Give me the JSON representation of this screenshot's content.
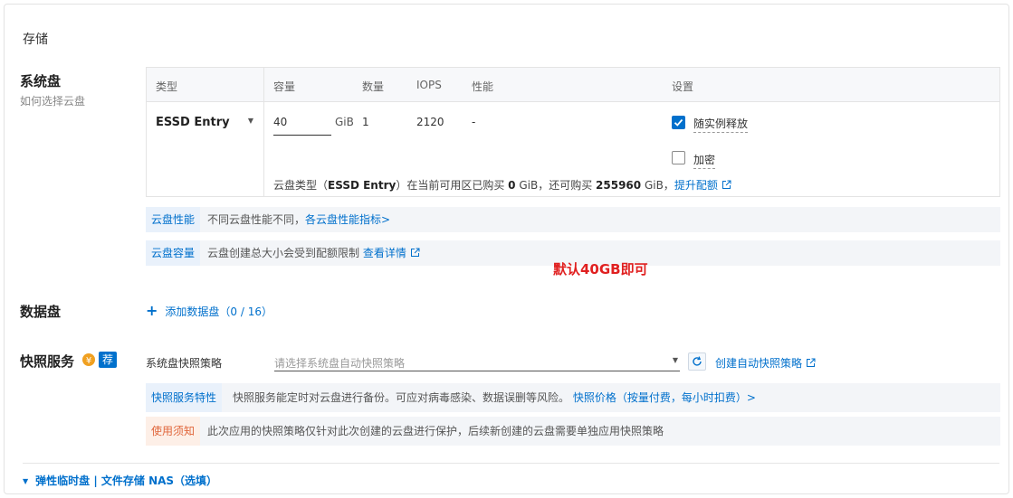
{
  "section_title": "存储",
  "system_disk": {
    "label": "系统盘",
    "help_link": "如何选择云盘",
    "table": {
      "headers": {
        "type": "类型",
        "capacity": "容量",
        "count": "数量",
        "iops": "IOPS",
        "performance": "性能",
        "settings": "设置"
      },
      "row": {
        "type": "ESSD Entry",
        "capacity": "40",
        "unit": "GiB",
        "count": "1",
        "iops": "2120",
        "performance": "-",
        "release_with_instance": "随实例释放",
        "release_checked": true,
        "encrypt": "加密",
        "encrypt_checked": false
      },
      "quota": {
        "prefix": "云盘类型（",
        "type": "ESSD Entry",
        "mid1": "）在当前可用区已购买 ",
        "bought": "0",
        "mid2": " GiB，还可购买 ",
        "remaining": "255960",
        "suffix": " GiB，",
        "link": "提升配额"
      }
    },
    "perf_bar": {
      "tag": "云盘性能",
      "text": "不同云盘性能不同，",
      "link": "各云盘性能指标>"
    },
    "capacity_bar": {
      "tag": "云盘容量",
      "text": "云盘创建总大小会受到配额限制",
      "link": "查看详情"
    },
    "annotation": "默认40GB即可"
  },
  "data_disk": {
    "label": "数据盘",
    "add_icon": "+",
    "add_text": "添加数据盘（0 / 16）"
  },
  "snapshot": {
    "label": "快照服务",
    "badge": "荐",
    "policy_label": "系统盘快照策略",
    "policy_placeholder": "请选择系统盘自动快照策略",
    "create_link": "创建自动快照策略",
    "feature_bar": {
      "tag": "快照服务特性",
      "text": "快照服务能定时对云盘进行备份。可应对病毒感染、数据误删等风险。",
      "link": "快照价格（按量付费，每小时扣费）>"
    },
    "notice_bar": {
      "tag": "使用须知",
      "text": "此次应用的快照策略仅针对此次创建的云盘进行保护，后续新创建的云盘需要单独应用快照策略"
    }
  },
  "footer": {
    "toggle_text": "弹性临时盘 | 文件存储 NAS（选填）"
  },
  "colors": {
    "accent": "#0070cc",
    "warning": "#e0663b",
    "annotation": "#e02020",
    "badge_orange": "#f0a020"
  }
}
